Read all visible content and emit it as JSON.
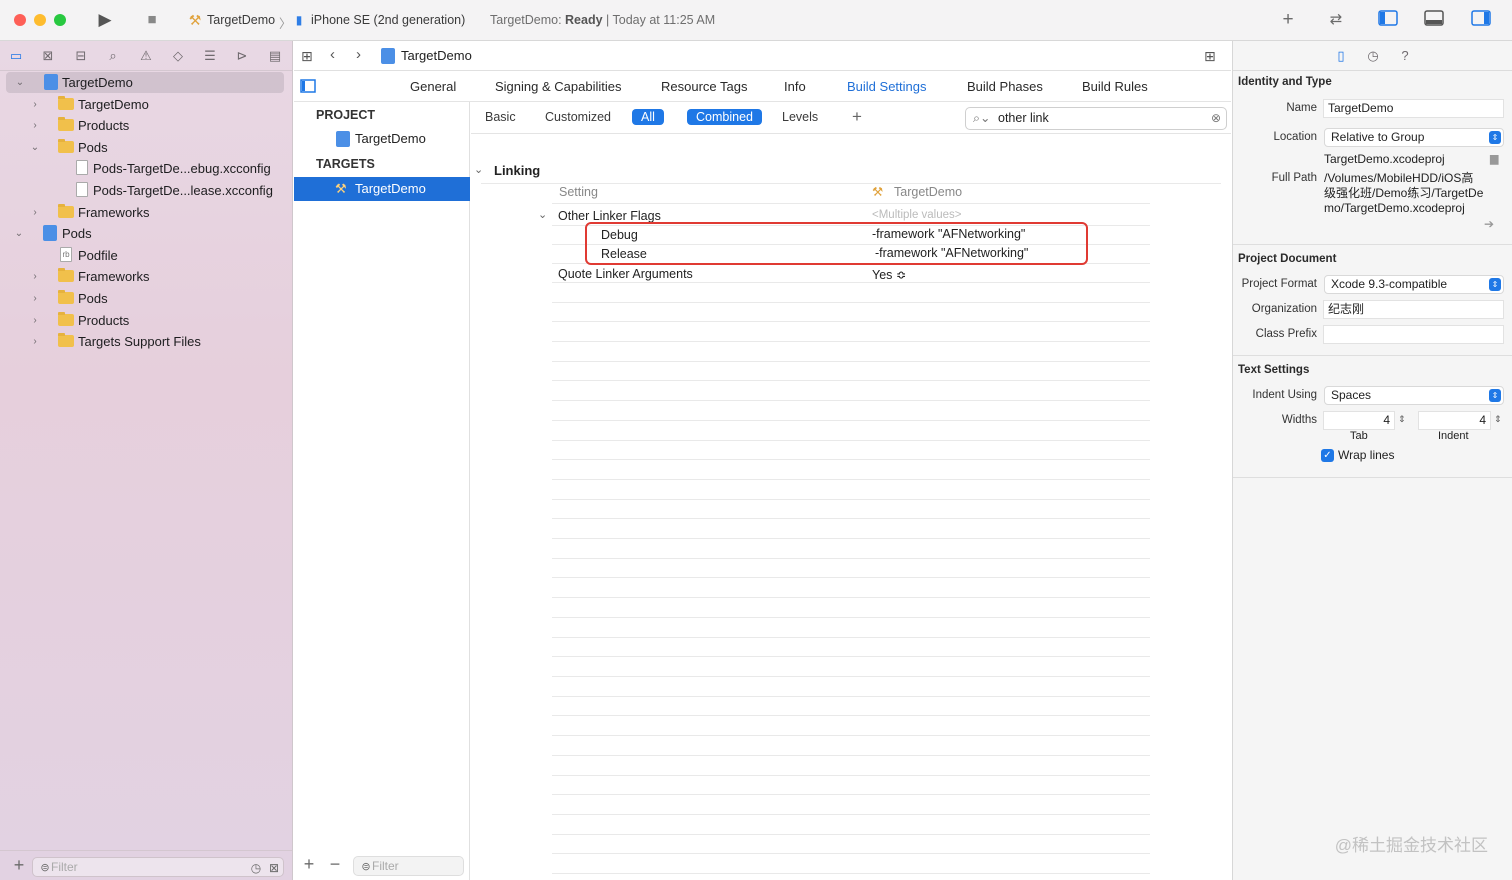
{
  "toolbar": {
    "scheme": "TargetDemo",
    "destination": "iPhone SE (2nd generation)",
    "status_project": "TargetDemo: ",
    "status_state": "Ready",
    "status_time": " | Today at 11:25 AM"
  },
  "navigator": {
    "items": [
      {
        "label": "TargetDemo"
      },
      {
        "label": "TargetDemo"
      },
      {
        "label": "Products"
      },
      {
        "label": "Pods"
      },
      {
        "label": "Pods-TargetDe...ebug.xcconfig"
      },
      {
        "label": "Pods-TargetDe...lease.xcconfig"
      },
      {
        "label": "Frameworks"
      },
      {
        "label": "Pods"
      },
      {
        "label": "Podfile"
      },
      {
        "label": "Frameworks"
      },
      {
        "label": "Pods"
      },
      {
        "label": "Products"
      },
      {
        "label": "Targets Support Files"
      }
    ],
    "filter_placeholder": "Filter"
  },
  "jumpbar": {
    "file": "TargetDemo"
  },
  "targets_panel": {
    "project_header": "PROJECT",
    "project_item": "TargetDemo",
    "targets_header": "TARGETS",
    "target_item": "TargetDemo",
    "filter_placeholder": "Filter"
  },
  "tabs": [
    "General",
    "Signing & Capabilities",
    "Resource Tags",
    "Info",
    "Build Settings",
    "Build Phases",
    "Build Rules"
  ],
  "build_settings": {
    "filters": {
      "basic": "Basic",
      "customized": "Customized",
      "all": "All",
      "combined": "Combined",
      "levels": "Levels"
    },
    "search_value": "other link",
    "section": "Linking",
    "col_setting": "Setting",
    "col_target": "TargetDemo",
    "rows": {
      "other_linker_flags": "Other Linker Flags",
      "multiple_values": "<Multiple values>",
      "debug_label": "Debug",
      "debug_value": "-framework \"AFNetworking\"",
      "release_label": "Release",
      "release_value": "-framework \"AFNetworking\"",
      "quote_linker_label": "Quote Linker Arguments",
      "quote_linker_value": "Yes ≎"
    }
  },
  "inspector": {
    "identity_title": "Identity and Type",
    "name_label": "Name",
    "name_value": "TargetDemo",
    "location_label": "Location",
    "location_value": "Relative to Group",
    "location_file": "TargetDemo.xcodeproj",
    "fullpath_label": "Full Path",
    "fullpath_value": "/Volumes/MobileHDD/iOS高级强化班/Demo练习/TargetDemo/TargetDemo.xcodeproj",
    "project_doc_title": "Project Document",
    "project_format_label": "Project Format",
    "project_format_value": "Xcode 9.3-compatible",
    "organization_label": "Organization",
    "organization_value": "纪志刚",
    "class_prefix_label": "Class Prefix",
    "class_prefix_value": "",
    "text_settings_title": "Text Settings",
    "indent_using_label": "Indent Using",
    "indent_using_value": "Spaces",
    "widths_label": "Widths",
    "tab_value": "4",
    "indent_value": "4",
    "tab_caption": "Tab",
    "indent_caption": "Indent",
    "wrap_lines_label": "Wrap lines"
  },
  "watermark": "@稀土掘金技术社区",
  "colors": {
    "accent": "#1f6fd7",
    "highlight_box": "#e03a33"
  }
}
